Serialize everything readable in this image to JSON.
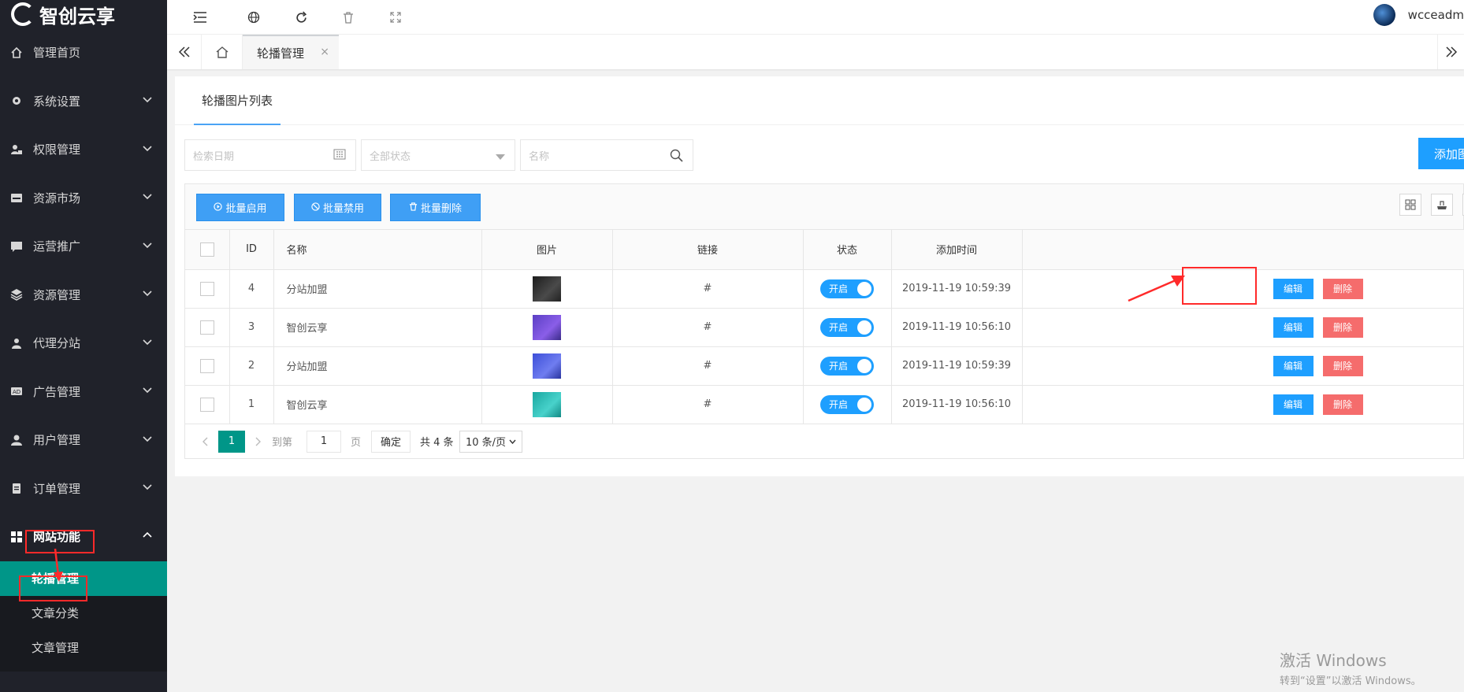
{
  "brand": {
    "name": "智创云享"
  },
  "sidebar": {
    "items": [
      {
        "label": "管理首页",
        "icon": "home-icon"
      },
      {
        "label": "系统设置",
        "icon": "gear-icon"
      },
      {
        "label": "权限管理",
        "icon": "user-lock-icon"
      },
      {
        "label": "资源市场",
        "icon": "store-icon"
      },
      {
        "label": "运营推广",
        "icon": "chat-icon"
      },
      {
        "label": "资源管理",
        "icon": "layers-icon"
      },
      {
        "label": "代理分站",
        "icon": "users-icon"
      },
      {
        "label": "广告管理",
        "icon": "ad-icon"
      },
      {
        "label": "用户管理",
        "icon": "user-icon"
      },
      {
        "label": "订单管理",
        "icon": "clipboard-icon"
      },
      {
        "label": "网站功能",
        "icon": "grid-icon"
      }
    ],
    "submenu": [
      {
        "label": "轮播管理"
      },
      {
        "label": "文章分类"
      },
      {
        "label": "文章管理"
      }
    ]
  },
  "topbar": {
    "username": "wcceadm"
  },
  "tabs": {
    "active": "轮播管理",
    "close": "×"
  },
  "card": {
    "title": "轮播图片列表"
  },
  "filters": {
    "date_placeholder": "检索日期",
    "status_placeholder": "全部状态",
    "name_placeholder": "名称",
    "add_button": "添加图"
  },
  "toolbar": {
    "enable_label": "批量启用",
    "disable_label": "批量禁用",
    "delete_label": "批量删除"
  },
  "table": {
    "headers": [
      "ID",
      "名称",
      "图片",
      "链接",
      "状态",
      "添加时间"
    ],
    "rows": [
      {
        "id": "4",
        "name": "分站加盟",
        "link": "#",
        "status": "开启",
        "time": "2019-11-19 10:59:39",
        "thumb": "dark"
      },
      {
        "id": "3",
        "name": "智创云享",
        "link": "#",
        "status": "开启",
        "time": "2019-11-19 10:56:10",
        "thumb": "purple"
      },
      {
        "id": "2",
        "name": "分站加盟",
        "link": "#",
        "status": "开启",
        "time": "2019-11-19 10:59:39",
        "thumb": "blue"
      },
      {
        "id": "1",
        "name": "智创云享",
        "link": "#",
        "status": "开启",
        "time": "2019-11-19 10:56:10",
        "thumb": "teal"
      }
    ],
    "edit_label": "编辑",
    "delete_label": "删除"
  },
  "pager": {
    "current_page": "1",
    "goto_label": "到第",
    "goto_value": "1",
    "page_label": "页",
    "confirm_label": "确定",
    "total_label": "共 4 条",
    "size_label": "10 条/页"
  },
  "watermark": {
    "line1": "激活 Windows",
    "line2": "转到“设置”以激活 Windows。"
  },
  "colors": {
    "sidebar_bg": "#20222a",
    "active_teal": "#009688",
    "primary_blue": "#1e9fff",
    "danger_red": "#f56c6c",
    "annotation_red": "#ff2a2a"
  }
}
